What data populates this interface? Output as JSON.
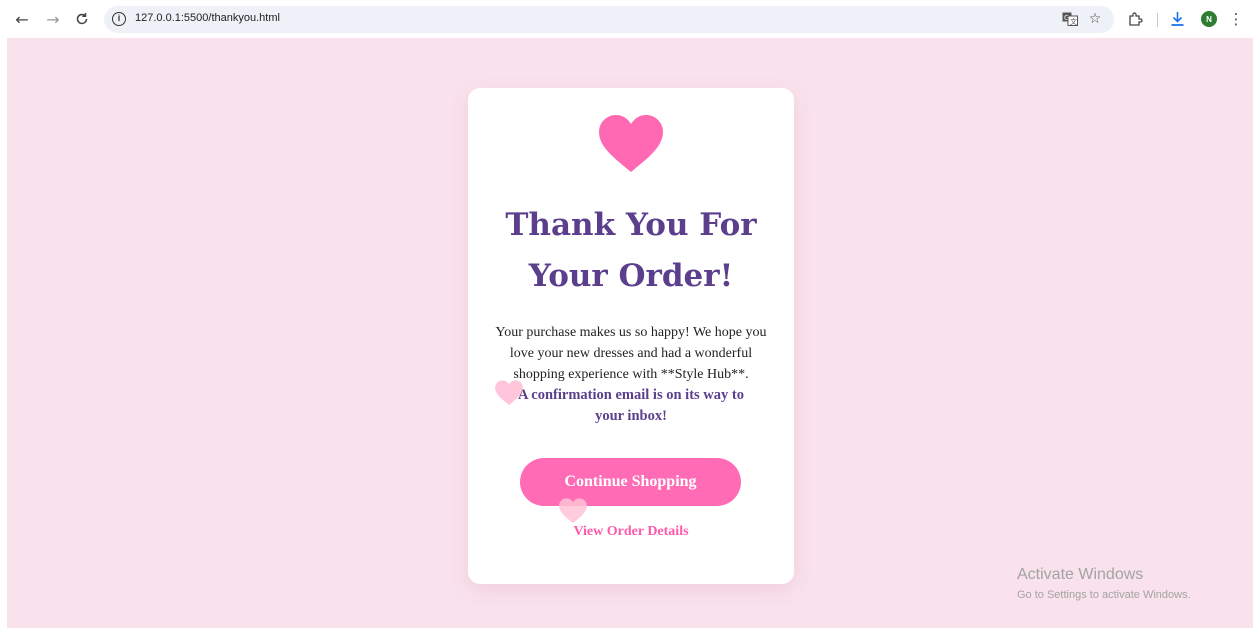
{
  "browser": {
    "url": "127.0.0.1:5500/thankyou.html",
    "avatar_letter": "N",
    "icons": [
      "back-arrow-icon",
      "forward-arrow-icon",
      "reload-icon",
      "info-icon",
      "translate-icon",
      "star-icon",
      "extensions-icon",
      "download-icon",
      "profile-avatar",
      "more-menu-icon"
    ]
  },
  "card": {
    "title_line1": "Thank You For",
    "title_line2": "Your Order!",
    "message_line1": "Your purchase makes us so happy! We hope you",
    "message_line2": "love your new dresses and had a wonderful",
    "message_line3": "shopping experience with **Style Hub**.",
    "confirmation_line1": "A confirmation email is on its way to",
    "confirmation_line2": "your inbox!",
    "continue_button": "Continue Shopping",
    "view_order_link": "View Order Details"
  },
  "colors": {
    "background": "#f9e2ec",
    "heart": "#ff69b4",
    "title": "#5b3f8c",
    "button": "#ff6cb5",
    "link": "#ff5aaa"
  },
  "watermark": {
    "title": "Activate Windows",
    "subtitle": "Go to Settings to activate Windows."
  }
}
